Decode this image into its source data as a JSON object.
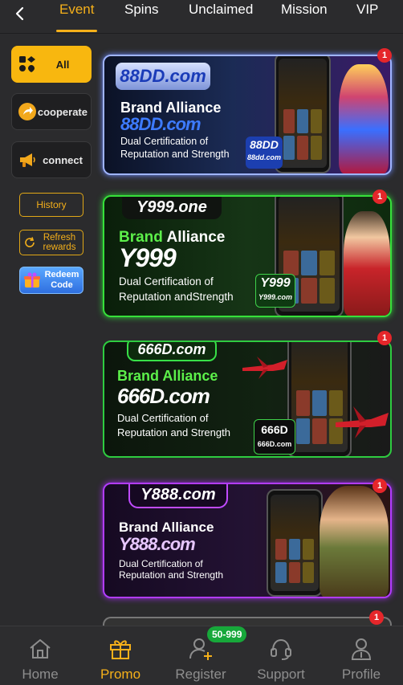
{
  "topbar": {
    "tabs": [
      {
        "label": "Event"
      },
      {
        "label": "Spins"
      },
      {
        "label": "Unclaimed"
      },
      {
        "label": "Mission"
      },
      {
        "label": "VIP"
      }
    ]
  },
  "sidebar": {
    "items": [
      {
        "label": "All",
        "icon": "grid-suits-icon"
      },
      {
        "label": "cooperate",
        "icon": "share-arrow-icon"
      },
      {
        "label": "connect",
        "icon": "megaphone-icon"
      }
    ],
    "history_label": "History",
    "refresh_label": "Refresh rewards",
    "redeem_label": "Redeem Code"
  },
  "banners": [
    {
      "logo": "88DD.com",
      "brand_word1": "Brand",
      "brand_word2": "Alliance",
      "big_logo": "88DD.com",
      "desc_line1": "Dual Certification of",
      "desc_line2": "Reputation and Strength",
      "site": "88dd.com",
      "badge": "1",
      "accent": "#9fb4ff"
    },
    {
      "logo": "Y999.one",
      "brand_word1": "Brand",
      "brand_word2": "Alliance",
      "big_logo": "Y999",
      "desc_line1": "Dual Certification of",
      "desc_line2": "Reputation andStrength",
      "site": "Y999.com",
      "badge": "1",
      "accent": "#36e03a"
    },
    {
      "logo": "666D.com",
      "brand_word1": "Brand",
      "brand_word2": "Alliance",
      "big_logo": "666D.com",
      "desc_line1": "Dual Certification of",
      "desc_line2": "Reputation and Strength",
      "site": "666D.com",
      "badge": "1",
      "accent": "#2ecc40"
    },
    {
      "logo": "Y888.com",
      "brand_word1": "Brand",
      "brand_word2": "Alliance",
      "big_logo": "Y888.com",
      "desc_line1": "Dual Certification of",
      "desc_line2": "Reputation and Strength",
      "site": "",
      "badge": "1",
      "accent": "#b23cff"
    },
    {
      "badge": "1"
    }
  ],
  "bottomnav": {
    "items": [
      {
        "label": "Home",
        "icon": "home-icon"
      },
      {
        "label": "Promo",
        "icon": "gift-icon"
      },
      {
        "label": "Register",
        "icon": "add-user-icon"
      },
      {
        "label": "Support",
        "icon": "headset-icon"
      },
      {
        "label": "Profile",
        "icon": "profile-icon"
      }
    ],
    "register_badge": "50-999"
  },
  "colors": {
    "accent": "#f5b01a",
    "background": "#2b2b2d",
    "badge_red": "#e5262a",
    "badge_green": "#17a83a"
  }
}
